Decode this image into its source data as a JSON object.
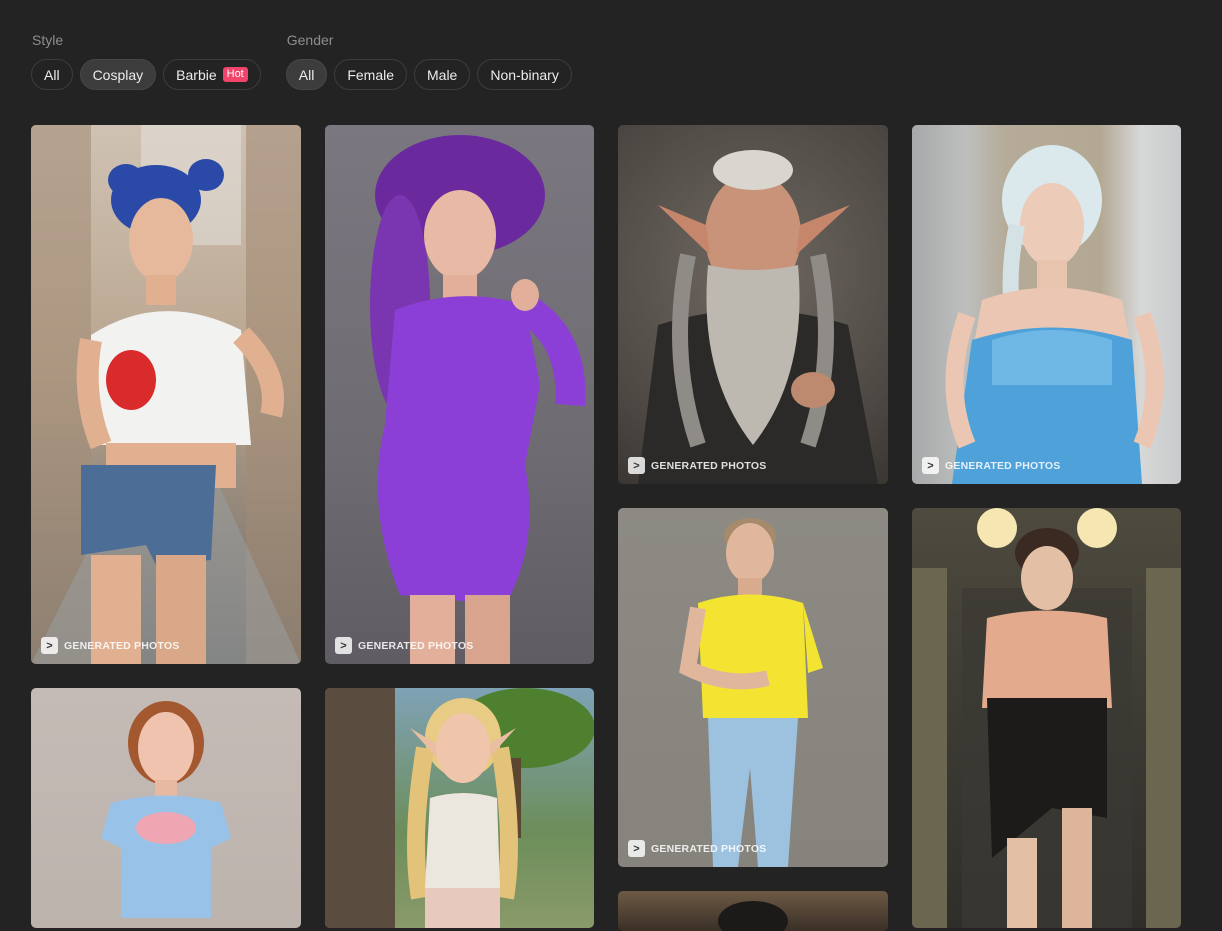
{
  "filters": {
    "style": {
      "label": "Style",
      "options": [
        {
          "label": "All",
          "selected": false
        },
        {
          "label": "Cosplay",
          "selected": true
        },
        {
          "label": "Barbie",
          "selected": false,
          "badge": "Hot"
        }
      ]
    },
    "gender": {
      "label": "Gender",
      "options": [
        {
          "label": "All",
          "selected": true
        },
        {
          "label": "Female",
          "selected": false
        },
        {
          "label": "Male",
          "selected": false
        },
        {
          "label": "Non-binary",
          "selected": false
        }
      ]
    }
  },
  "watermark_text": "GENERATED PHOTOS",
  "watermark_logo": ">",
  "colors": {
    "background": "#232323",
    "chip_border": "#3d3d3d",
    "chip_selected": "#3c3c3c",
    "hot_badge": "#f0446a"
  },
  "cards": [
    {
      "id": "blue-hair-woman",
      "watermark": true
    },
    {
      "id": "purple-dress-woman",
      "watermark": true
    },
    {
      "id": "elf-old-man",
      "watermark": true
    },
    {
      "id": "ice-princess-woman",
      "watermark": true
    },
    {
      "id": "yellow-shirt-boy",
      "watermark": true
    },
    {
      "id": "leather-skirt-woman",
      "watermark": false
    },
    {
      "id": "doll-woman",
      "watermark": false
    },
    {
      "id": "elf-woman",
      "watermark": false
    },
    {
      "id": "partial-card",
      "watermark": false
    }
  ]
}
